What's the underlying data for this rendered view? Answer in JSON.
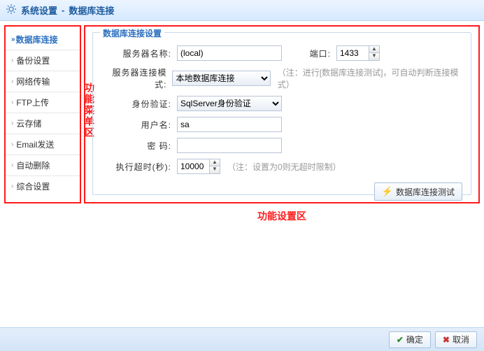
{
  "title": {
    "main": "系统设置",
    "sep": "-",
    "sub": "数据库连接"
  },
  "sidebar": {
    "items": [
      {
        "label": "数据库连接",
        "active": true
      },
      {
        "label": "备份设置"
      },
      {
        "label": "网络传输"
      },
      {
        "label": "FTP上传"
      },
      {
        "label": "云存储"
      },
      {
        "label": "Email发送"
      },
      {
        "label": "自动删除"
      },
      {
        "label": "综合设置"
      }
    ]
  },
  "annot": {
    "sidebar": "功能菜单区",
    "main": "功能设置区"
  },
  "form": {
    "legend": "数据库连接设置",
    "server_label": "服务器名称:",
    "server_value": "(local)",
    "port_label": "端口:",
    "port_value": "1433",
    "mode_label": "服务器连接模式:",
    "mode_value": "本地数据库连接",
    "mode_hint": "（注：进行[数据库连接测试]，可自动判断连接模式）",
    "auth_label": "身份验证:",
    "auth_value": "SqlServer身份验证",
    "user_label": "用户名:",
    "user_value": "sa",
    "pwd_label": "密  码:",
    "pwd_value": "",
    "timeout_label": "执行超时(秒):",
    "timeout_value": "10000",
    "timeout_hint": "（注：设置为0则无超时限制）",
    "test_btn": "数据库连接测试"
  },
  "footer": {
    "ok": "确定",
    "cancel": "取消"
  }
}
